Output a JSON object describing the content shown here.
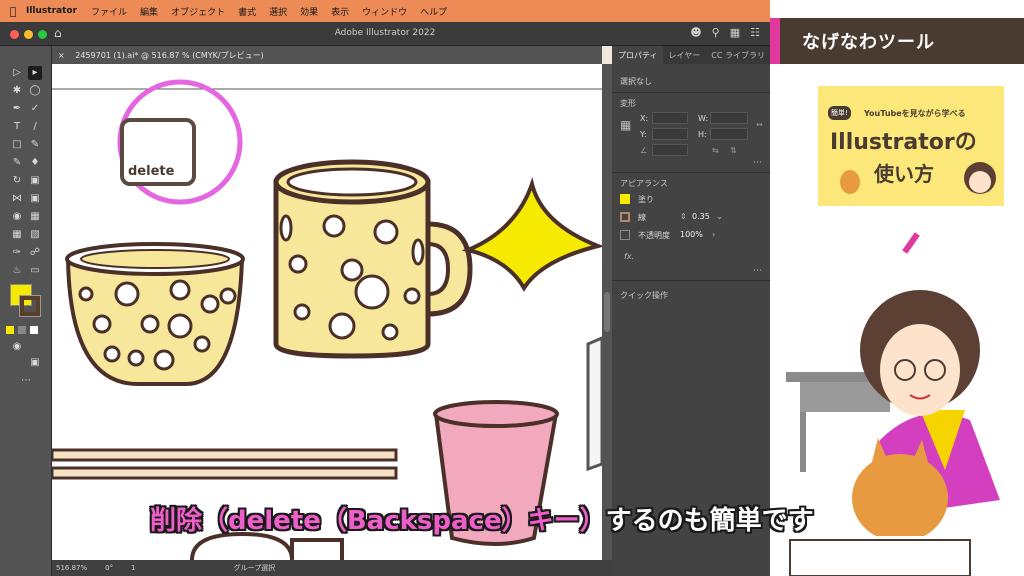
{
  "menubar": {
    "app_name": "Illustrator",
    "items": [
      "ファイル",
      "編集",
      "オブジェクト",
      "書式",
      "選択",
      "効果",
      "表示",
      "ウィンドウ",
      "ヘルプ"
    ]
  },
  "window": {
    "title": "Adobe Illustrator 2022"
  },
  "document_tab": {
    "label": "2459701 (1).ai* @ 516.87 % (CMYK/プレビュー)"
  },
  "artwork": {
    "delete_key_label": "delete"
  },
  "status_bar": {
    "zoom": "516.87%",
    "rotation": "0°",
    "artboard": "1",
    "mode": "グループ選択"
  },
  "panel": {
    "tabs": [
      "プロパティ",
      "レイヤー",
      "CC ライブラリ"
    ],
    "selection": "選択なし",
    "transform": {
      "title": "変形",
      "x_label": "X:",
      "y_label": "Y:",
      "w_label": "W:",
      "h_label": "H:",
      "x_value": "",
      "y_value": "",
      "w_value": "",
      "h_value": ""
    },
    "appearance": {
      "title": "アピアランス",
      "fill_label": "塗り",
      "stroke_label": "線",
      "stroke_value": "0.35",
      "opacity_label": "不透明度",
      "opacity_value": "100%",
      "fx_label": "fx."
    },
    "quick_actions": {
      "title": "クイック操作"
    }
  },
  "video": {
    "topic": "なげなわツール",
    "logo_badge": "簡単!",
    "logo_subtitle": "YouTubeを見ながら学べる",
    "logo_line1": "Illustratorの",
    "logo_line2": "使い方",
    "caption_pink": "削除（delete（Backspace）キー）",
    "caption_white": "するのも簡単です"
  },
  "colors": {
    "fill_swatch": "#f6ea00",
    "menubar_bg": "#ec8b55",
    "accent_pink": "#e0389c"
  }
}
